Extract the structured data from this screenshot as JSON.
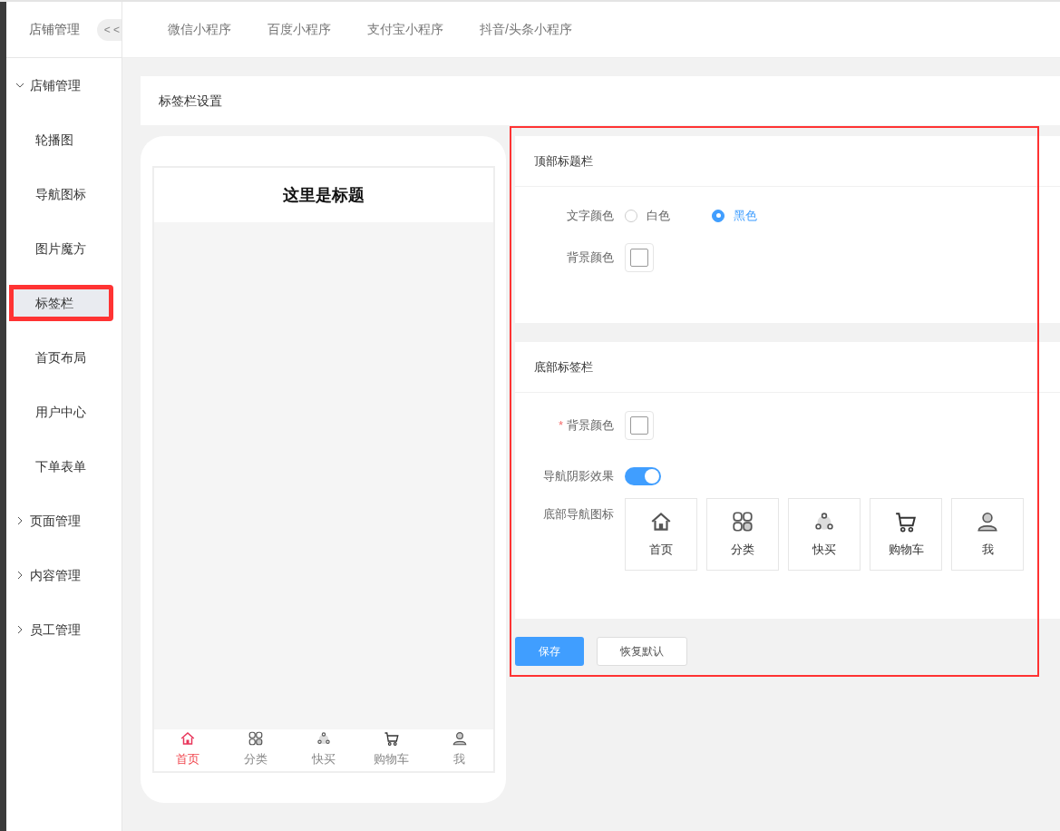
{
  "sidebar": {
    "title": "店铺管理",
    "collapse_button": "< <",
    "groups": [
      {
        "label": "店铺管理",
        "expanded": true,
        "children": [
          {
            "label": "轮播图",
            "selected": false,
            "highlighted": false
          },
          {
            "label": "导航图标",
            "selected": false,
            "highlighted": false
          },
          {
            "label": "图片魔方",
            "selected": false,
            "highlighted": false
          },
          {
            "label": "标签栏",
            "selected": true,
            "highlighted": true
          },
          {
            "label": "首页布局",
            "selected": false,
            "highlighted": false
          },
          {
            "label": "用户中心",
            "selected": false,
            "highlighted": false
          },
          {
            "label": "下单表单",
            "selected": false,
            "highlighted": false
          }
        ]
      },
      {
        "label": "页面管理",
        "expanded": false
      },
      {
        "label": "内容管理",
        "expanded": false
      },
      {
        "label": "员工管理",
        "expanded": false
      }
    ]
  },
  "tabs": [
    {
      "label": "微信小程序",
      "selected": false
    },
    {
      "label": "百度小程序",
      "selected": false
    },
    {
      "label": "支付宝小程序",
      "selected": false
    },
    {
      "label": "抖音/头条小程序",
      "selected": false
    }
  ],
  "page_title": "标签栏设置",
  "preview": {
    "title": "这里是标题",
    "tabbar": [
      {
        "label": "首页",
        "selected": true
      },
      {
        "label": "分类",
        "selected": false
      },
      {
        "label": "快买",
        "selected": false
      },
      {
        "label": "购物车",
        "selected": false
      },
      {
        "label": "我",
        "selected": false
      }
    ]
  },
  "settings": {
    "highlighted": true,
    "top_section": {
      "title": "顶部标题栏",
      "text_color_label": "文字颜色",
      "text_color_options": [
        {
          "label": "白色",
          "selected": false
        },
        {
          "label": "黑色",
          "selected": true
        }
      ],
      "bg_color_label": "背景颜色"
    },
    "bottom_section": {
      "title": "底部标签栏",
      "bg_color_label": "背景颜色",
      "required_mark": "*",
      "shadow_label": "导航阴影效果",
      "shadow_on": true,
      "icons_label": "底部导航图标",
      "icons": [
        {
          "label": "首页"
        },
        {
          "label": "分类"
        },
        {
          "label": "快买"
        },
        {
          "label": "购物车"
        },
        {
          "label": "我"
        }
      ]
    },
    "buttons": [
      {
        "label": "保存",
        "kind": "primary"
      },
      {
        "label": "恢复默认",
        "kind": "default"
      }
    ]
  }
}
